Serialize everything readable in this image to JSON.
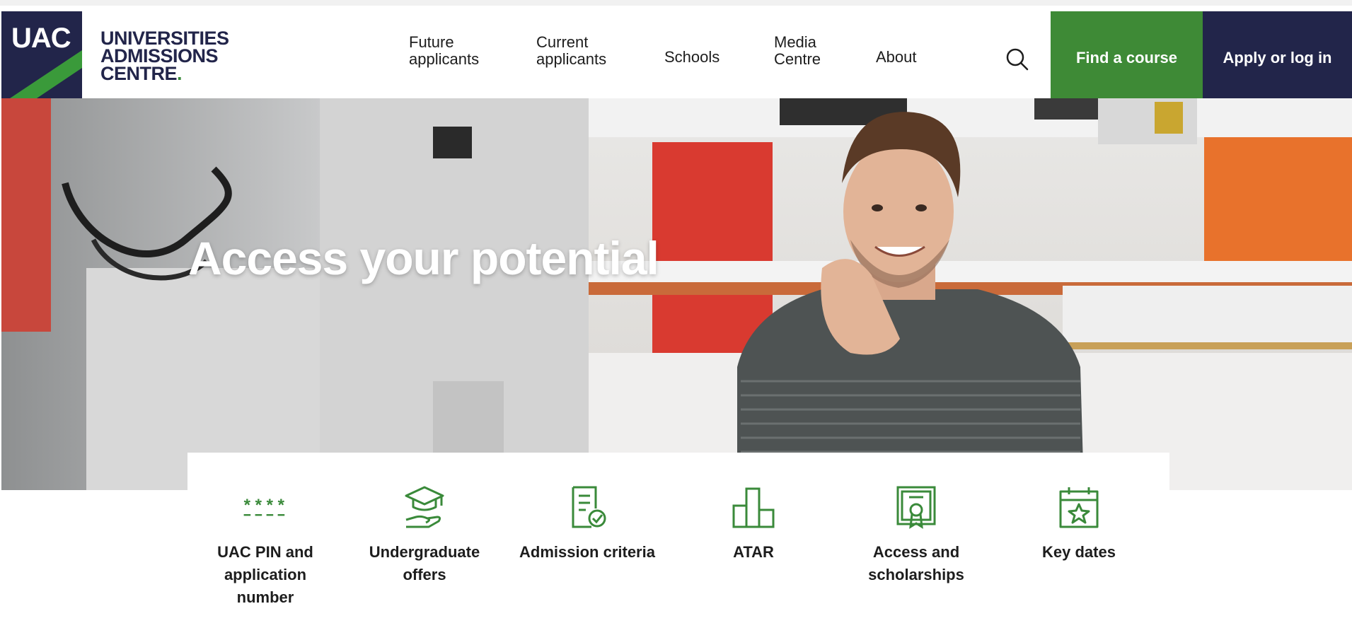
{
  "logo": {
    "mark": "UAC",
    "line1": "UNIVERSITIES",
    "line2": "ADMISSIONS",
    "line3": "CENTRE",
    "dot": "."
  },
  "nav": {
    "items": [
      {
        "label": "Future\napplicants"
      },
      {
        "label": "Current\napplicants"
      },
      {
        "label": "Schools"
      },
      {
        "label": "Media\nCentre"
      },
      {
        "label": "About"
      }
    ],
    "active": "Media Centre"
  },
  "actions": {
    "find_course": "Find a course",
    "apply_login": "Apply or log in"
  },
  "hero": {
    "title": "Access your potential"
  },
  "quick_links": [
    {
      "label": "UAC PIN and\napplication\nnumber",
      "icon": "pin-asterisks-icon"
    },
    {
      "label": "Undergraduate\noffers",
      "icon": "graduation-cap-hand-icon"
    },
    {
      "label": "Admission criteria",
      "icon": "document-check-icon"
    },
    {
      "label": "ATAR",
      "icon": "bar-chart-icon"
    },
    {
      "label": "Access and\nscholarships",
      "icon": "certificate-icon"
    },
    {
      "label": "Key dates",
      "icon": "calendar-star-icon"
    }
  ],
  "colors": {
    "navy": "#22254a",
    "green": "#3e8a36",
    "accent_green": "#3a8a3a"
  }
}
